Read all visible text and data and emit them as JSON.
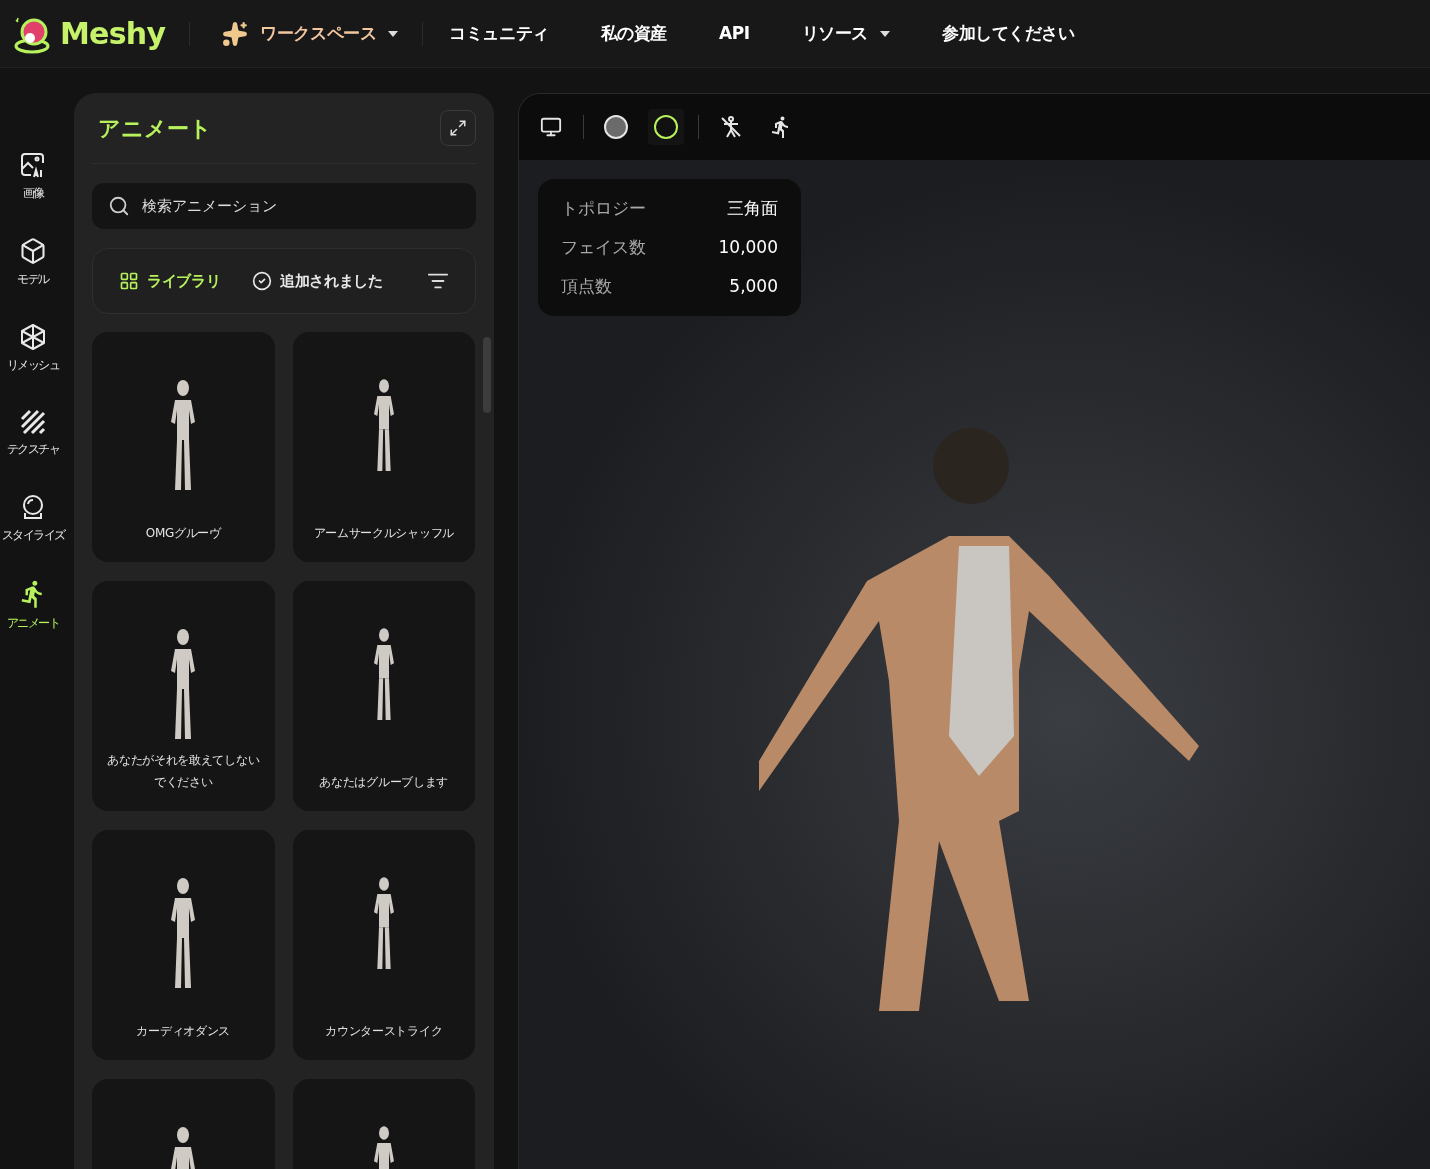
{
  "nav": {
    "logo": "Meshy",
    "items": [
      {
        "label": "ワークスペース",
        "kind": "workspace",
        "dropdown": true
      },
      {
        "label": "コミュニティ",
        "kind": "link",
        "dropdown": false
      },
      {
        "label": "私の資産",
        "kind": "link",
        "dropdown": false
      },
      {
        "label": "API",
        "kind": "link",
        "dropdown": false
      },
      {
        "label": "リソース",
        "kind": "link",
        "dropdown": true
      },
      {
        "label": "参加してください",
        "kind": "link",
        "dropdown": false
      }
    ]
  },
  "rail": [
    {
      "label": "画像",
      "kind": "image",
      "selected": false
    },
    {
      "label": "モデル",
      "kind": "model",
      "selected": false
    },
    {
      "label": "リメッシュ",
      "kind": "remesh",
      "selected": false
    },
    {
      "label": "テクスチャ",
      "kind": "texture",
      "selected": false
    },
    {
      "label": "スタイライズ",
      "kind": "stylize",
      "selected": false
    },
    {
      "label": "アニメート",
      "kind": "animate",
      "selected": true
    }
  ],
  "panel": {
    "title": "アニメート",
    "search": {
      "placeholder": "検索アニメーション"
    },
    "tabs": [
      {
        "label": "ライブラリ",
        "kind": "library",
        "selected": true
      },
      {
        "label": "追加されました",
        "kind": "added",
        "selected": false
      }
    ],
    "cards": [
      {
        "kind": "full",
        "label": "OMGグルーヴ"
      },
      {
        "kind": "full",
        "label": "アームサークルシャッフル"
      },
      {
        "kind": "full",
        "label": "あなたがそれを敢えてしないでください"
      },
      {
        "kind": "full",
        "label": "あなたはグルーブします"
      },
      {
        "kind": "full",
        "label": "カーディオダンス"
      },
      {
        "kind": "full",
        "label": "カウンターストライク"
      },
      {
        "kind": "cut"
      },
      {
        "kind": "cut"
      }
    ]
  },
  "viewport": {
    "toolbar": [
      {
        "kind": "monitor",
        "selected": false
      },
      {
        "kind": "divider"
      },
      {
        "kind": "solid",
        "selected": false
      },
      {
        "kind": "textured",
        "selected": true
      },
      {
        "kind": "divider"
      },
      {
        "kind": "skeleton",
        "selected": false
      },
      {
        "kind": "run",
        "selected": false
      }
    ],
    "stats": [
      {
        "label": "トポロジー",
        "value": "三角面"
      },
      {
        "label": "フェイス数",
        "value": "10,000"
      },
      {
        "label": "頂点数",
        "value": "5,000"
      }
    ]
  }
}
